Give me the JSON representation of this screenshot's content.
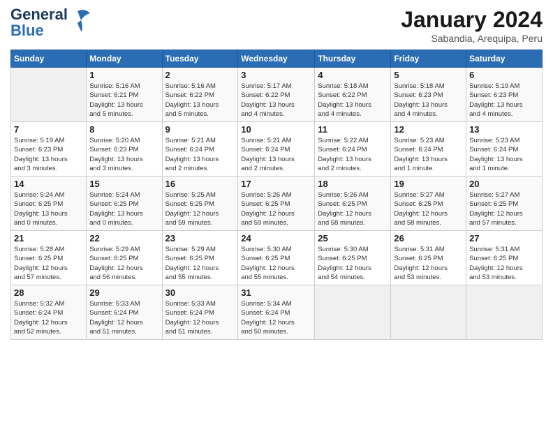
{
  "header": {
    "logo_line1": "General",
    "logo_line2": "Blue",
    "month": "January 2024",
    "location": "Sabandia, Arequipa, Peru"
  },
  "weekdays": [
    "Sunday",
    "Monday",
    "Tuesday",
    "Wednesday",
    "Thursday",
    "Friday",
    "Saturday"
  ],
  "weeks": [
    [
      {
        "day": "",
        "info": ""
      },
      {
        "day": "1",
        "info": "Sunrise: 5:16 AM\nSunset: 6:21 PM\nDaylight: 13 hours\nand 5 minutes."
      },
      {
        "day": "2",
        "info": "Sunrise: 5:16 AM\nSunset: 6:22 PM\nDaylight: 13 hours\nand 5 minutes."
      },
      {
        "day": "3",
        "info": "Sunrise: 5:17 AM\nSunset: 6:22 PM\nDaylight: 13 hours\nand 4 minutes."
      },
      {
        "day": "4",
        "info": "Sunrise: 5:18 AM\nSunset: 6:22 PM\nDaylight: 13 hours\nand 4 minutes."
      },
      {
        "day": "5",
        "info": "Sunrise: 5:18 AM\nSunset: 6:23 PM\nDaylight: 13 hours\nand 4 minutes."
      },
      {
        "day": "6",
        "info": "Sunrise: 5:19 AM\nSunset: 6:23 PM\nDaylight: 13 hours\nand 4 minutes."
      }
    ],
    [
      {
        "day": "7",
        "info": "Sunrise: 5:19 AM\nSunset: 6:23 PM\nDaylight: 13 hours\nand 3 minutes."
      },
      {
        "day": "8",
        "info": "Sunrise: 5:20 AM\nSunset: 6:23 PM\nDaylight: 13 hours\nand 3 minutes."
      },
      {
        "day": "9",
        "info": "Sunrise: 5:21 AM\nSunset: 6:24 PM\nDaylight: 13 hours\nand 2 minutes."
      },
      {
        "day": "10",
        "info": "Sunrise: 5:21 AM\nSunset: 6:24 PM\nDaylight: 13 hours\nand 2 minutes."
      },
      {
        "day": "11",
        "info": "Sunrise: 5:22 AM\nSunset: 6:24 PM\nDaylight: 13 hours\nand 2 minutes."
      },
      {
        "day": "12",
        "info": "Sunrise: 5:23 AM\nSunset: 6:24 PM\nDaylight: 13 hours\nand 1 minute."
      },
      {
        "day": "13",
        "info": "Sunrise: 5:23 AM\nSunset: 6:24 PM\nDaylight: 13 hours\nand 1 minute."
      }
    ],
    [
      {
        "day": "14",
        "info": "Sunrise: 5:24 AM\nSunset: 6:25 PM\nDaylight: 13 hours\nand 0 minutes."
      },
      {
        "day": "15",
        "info": "Sunrise: 5:24 AM\nSunset: 6:25 PM\nDaylight: 13 hours\nand 0 minutes."
      },
      {
        "day": "16",
        "info": "Sunrise: 5:25 AM\nSunset: 6:25 PM\nDaylight: 12 hours\nand 59 minutes."
      },
      {
        "day": "17",
        "info": "Sunrise: 5:26 AM\nSunset: 6:25 PM\nDaylight: 12 hours\nand 59 minutes."
      },
      {
        "day": "18",
        "info": "Sunrise: 5:26 AM\nSunset: 6:25 PM\nDaylight: 12 hours\nand 58 minutes."
      },
      {
        "day": "19",
        "info": "Sunrise: 5:27 AM\nSunset: 6:25 PM\nDaylight: 12 hours\nand 58 minutes."
      },
      {
        "day": "20",
        "info": "Sunrise: 5:27 AM\nSunset: 6:25 PM\nDaylight: 12 hours\nand 57 minutes."
      }
    ],
    [
      {
        "day": "21",
        "info": "Sunrise: 5:28 AM\nSunset: 6:25 PM\nDaylight: 12 hours\nand 57 minutes."
      },
      {
        "day": "22",
        "info": "Sunrise: 5:29 AM\nSunset: 6:25 PM\nDaylight: 12 hours\nand 56 minutes."
      },
      {
        "day": "23",
        "info": "Sunrise: 5:29 AM\nSunset: 6:25 PM\nDaylight: 12 hours\nand 55 minutes."
      },
      {
        "day": "24",
        "info": "Sunrise: 5:30 AM\nSunset: 6:25 PM\nDaylight: 12 hours\nand 55 minutes."
      },
      {
        "day": "25",
        "info": "Sunrise: 5:30 AM\nSunset: 6:25 PM\nDaylight: 12 hours\nand 54 minutes."
      },
      {
        "day": "26",
        "info": "Sunrise: 5:31 AM\nSunset: 6:25 PM\nDaylight: 12 hours\nand 53 minutes."
      },
      {
        "day": "27",
        "info": "Sunrise: 5:31 AM\nSunset: 6:25 PM\nDaylight: 12 hours\nand 53 minutes."
      }
    ],
    [
      {
        "day": "28",
        "info": "Sunrise: 5:32 AM\nSunset: 6:24 PM\nDaylight: 12 hours\nand 52 minutes."
      },
      {
        "day": "29",
        "info": "Sunrise: 5:33 AM\nSunset: 6:24 PM\nDaylight: 12 hours\nand 51 minutes."
      },
      {
        "day": "30",
        "info": "Sunrise: 5:33 AM\nSunset: 6:24 PM\nDaylight: 12 hours\nand 51 minutes."
      },
      {
        "day": "31",
        "info": "Sunrise: 5:34 AM\nSunset: 6:24 PM\nDaylight: 12 hours\nand 50 minutes."
      },
      {
        "day": "",
        "info": ""
      },
      {
        "day": "",
        "info": ""
      },
      {
        "day": "",
        "info": ""
      }
    ]
  ]
}
